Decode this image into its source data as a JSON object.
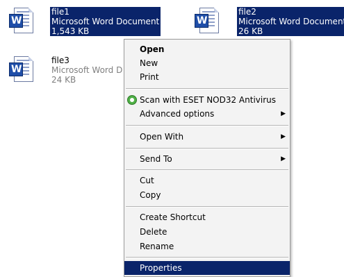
{
  "files": [
    {
      "name": "file1",
      "type": "Microsoft Word Document",
      "size": "1,543 KB",
      "selected": true
    },
    {
      "name": "file2",
      "type": "Microsoft Word Document",
      "size": "26 KB",
      "selected": true
    },
    {
      "name": "file3",
      "type": "Microsoft Word D",
      "size": "24 KB",
      "selected": false
    }
  ],
  "menu": {
    "open": "Open",
    "new": "New",
    "print": "Print",
    "scan": "Scan with ESET NOD32 Antivirus",
    "advanced": "Advanced options",
    "open_with": "Open With",
    "send_to": "Send To",
    "cut": "Cut",
    "copy": "Copy",
    "create_shortcut": "Create Shortcut",
    "delete": "Delete",
    "rename": "Rename",
    "properties": "Properties",
    "submenu_arrow": "▶",
    "icons": {
      "scan": "eset-antivirus-icon",
      "submenu": "submenu-arrow-icon"
    },
    "highlighted_item": "Properties"
  },
  "colors": {
    "selection": "#0a246a",
    "menu_bg": "#f3f3f3",
    "dim_text": "#7f7f7f"
  }
}
